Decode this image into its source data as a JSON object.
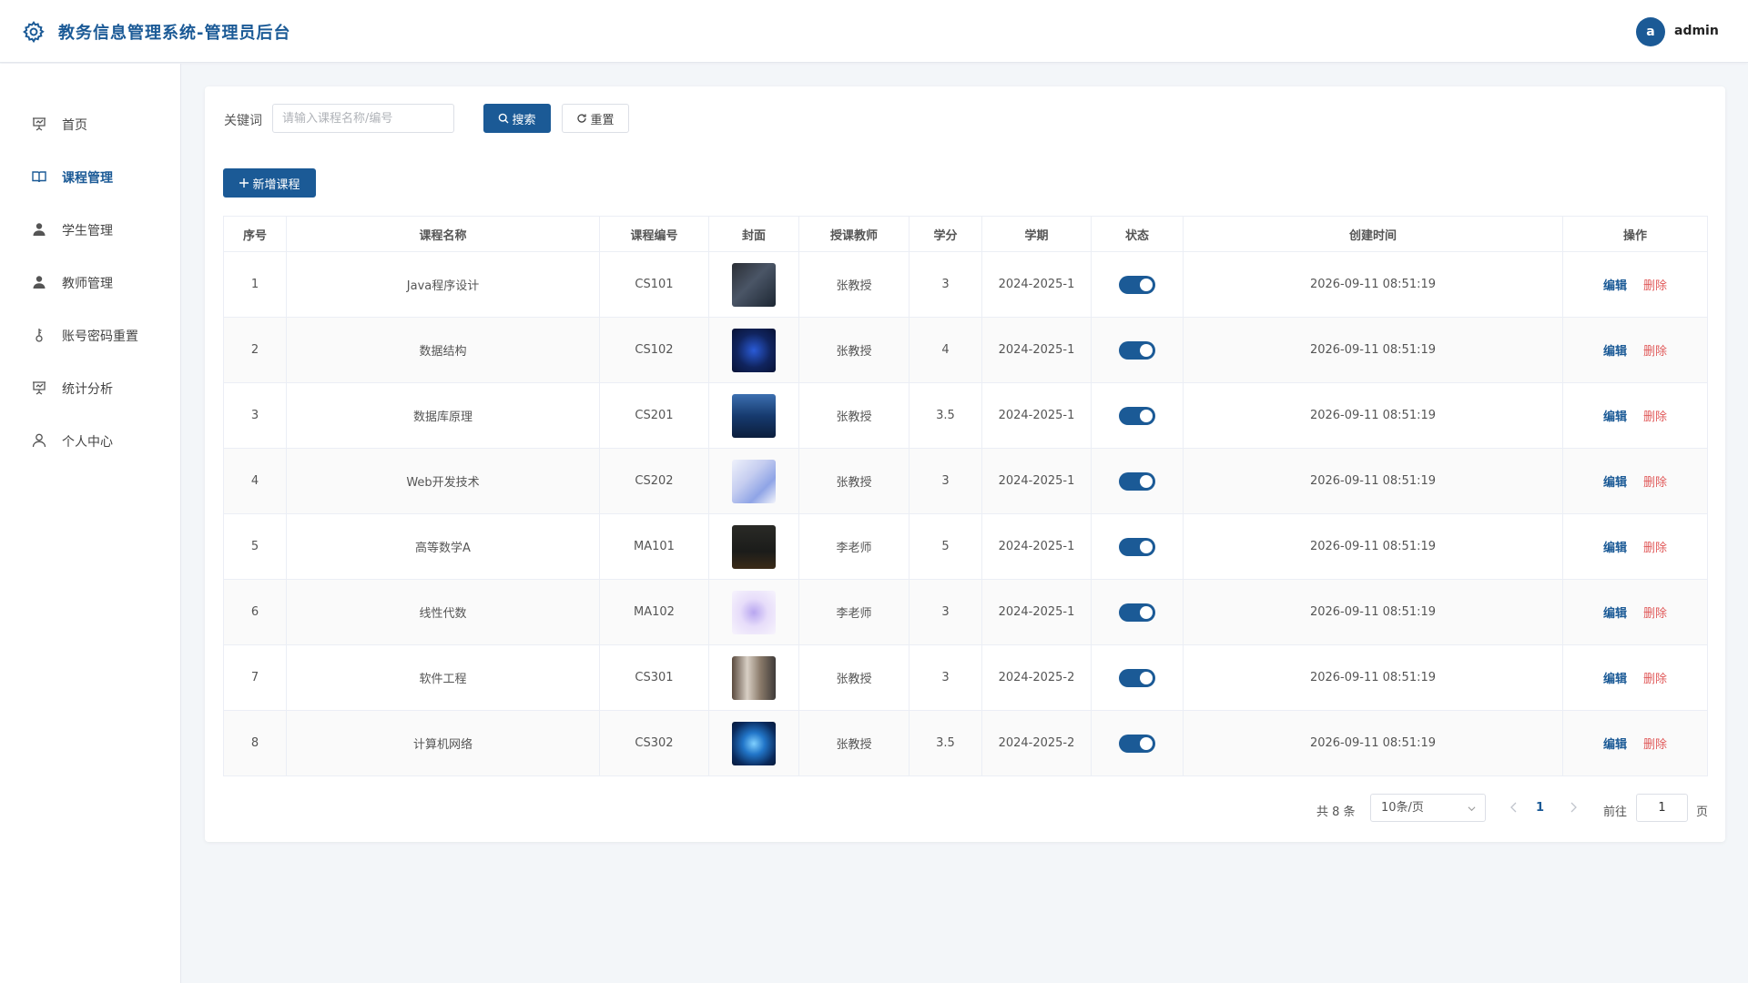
{
  "header": {
    "title": "教务信息管理系统-管理员后台",
    "avatar_letter": "a",
    "username": "admin"
  },
  "sidebar": {
    "items": [
      {
        "label": "首页",
        "icon": "presentation-icon",
        "active": false
      },
      {
        "label": "课程管理",
        "icon": "book-icon",
        "active": true
      },
      {
        "label": "学生管理",
        "icon": "user-solid-icon",
        "active": false
      },
      {
        "label": "教师管理",
        "icon": "user-solid-icon",
        "active": false
      },
      {
        "label": "账号密码重置",
        "icon": "key-icon",
        "active": false
      },
      {
        "label": "统计分析",
        "icon": "presentation-icon",
        "active": false
      },
      {
        "label": "个人中心",
        "icon": "user-outline-icon",
        "active": false
      }
    ]
  },
  "search": {
    "label": "关键词",
    "placeholder": "请输入课程名称/编号",
    "value": "",
    "search_button": "搜索",
    "reset_button": "重置"
  },
  "toolbar": {
    "add_button": "新增课程"
  },
  "table": {
    "columns": [
      "序号",
      "课程名称",
      "课程编号",
      "封面",
      "授课教师",
      "学分",
      "学期",
      "状态",
      "创建时间",
      "操作"
    ],
    "rows": [
      {
        "index": "1",
        "name": "Java程序设计",
        "code": "CS101",
        "teacher": "张教授",
        "credit": "3",
        "term": "2024-2025-1",
        "status": true,
        "created": "2026-09-11 08:51:19"
      },
      {
        "index": "2",
        "name": "数据结构",
        "code": "CS102",
        "teacher": "张教授",
        "credit": "4",
        "term": "2024-2025-1",
        "status": true,
        "created": "2026-09-11 08:51:19"
      },
      {
        "index": "3",
        "name": "数据库原理",
        "code": "CS201",
        "teacher": "张教授",
        "credit": "3.5",
        "term": "2024-2025-1",
        "status": true,
        "created": "2026-09-11 08:51:19"
      },
      {
        "index": "4",
        "name": "Web开发技术",
        "code": "CS202",
        "teacher": "张教授",
        "credit": "3",
        "term": "2024-2025-1",
        "status": true,
        "created": "2026-09-11 08:51:19"
      },
      {
        "index": "5",
        "name": "高等数学A",
        "code": "MA101",
        "teacher": "李老师",
        "credit": "5",
        "term": "2024-2025-1",
        "status": true,
        "created": "2026-09-11 08:51:19"
      },
      {
        "index": "6",
        "name": "线性代数",
        "code": "MA102",
        "teacher": "李老师",
        "credit": "3",
        "term": "2024-2025-1",
        "status": true,
        "created": "2026-09-11 08:51:19"
      },
      {
        "index": "7",
        "name": "软件工程",
        "code": "CS301",
        "teacher": "张教授",
        "credit": "3",
        "term": "2024-2025-2",
        "status": true,
        "created": "2026-09-11 08:51:19"
      },
      {
        "index": "8",
        "name": "计算机网络",
        "code": "CS302",
        "teacher": "张教授",
        "credit": "3.5",
        "term": "2024-2025-2",
        "status": true,
        "created": "2026-09-11 08:51:19"
      }
    ],
    "actions": {
      "edit": "编辑",
      "delete": "删除"
    }
  },
  "pagination": {
    "total_text": "共 8 条",
    "page_size": "10条/页",
    "current_page": "1",
    "goto_label": "前往",
    "goto_value": "1",
    "page_suffix": "页"
  },
  "colors": {
    "accent": "#1b5a96",
    "danger": "#e05a5a",
    "background": "#f3f6f9"
  }
}
